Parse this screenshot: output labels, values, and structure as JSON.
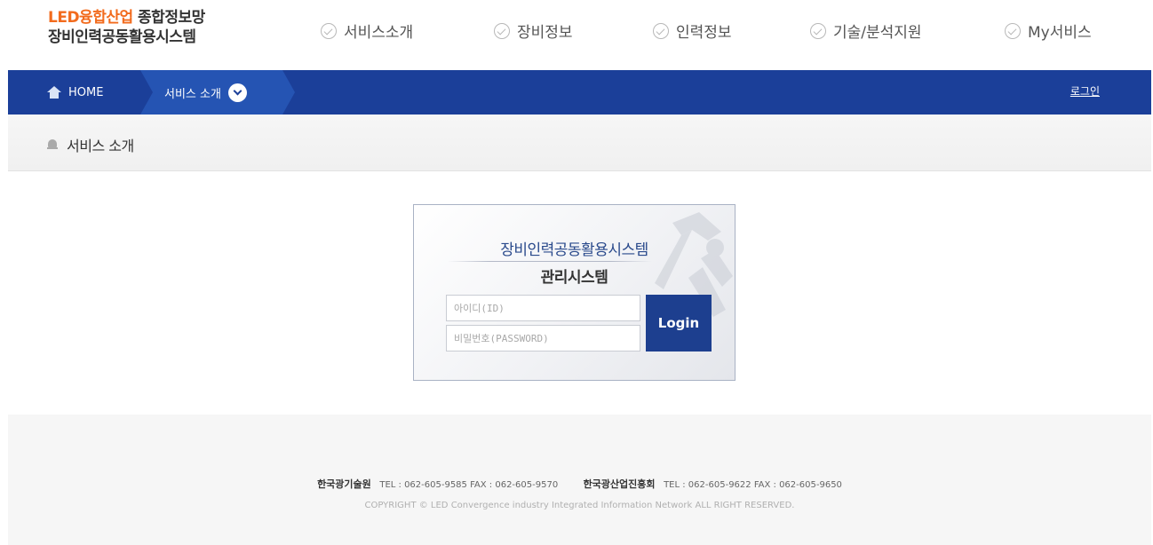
{
  "header": {
    "logo": {
      "orange_text": "LED융합산업",
      "dark_text": "종합정보망",
      "line2": "장비인력공동활용시스템"
    },
    "menu": [
      {
        "label": "서비스소개",
        "icon": "check-circle-icon"
      },
      {
        "label": "장비정보",
        "icon": "check-circle-icon"
      },
      {
        "label": "인력정보",
        "icon": "check-circle-icon"
      },
      {
        "label": "기술/분석지원",
        "icon": "check-circle-icon"
      },
      {
        "label": "My서비스",
        "icon": "check-circle-icon"
      }
    ]
  },
  "navbar": {
    "home_label": "HOME",
    "breadcrumb_label": "서비스 소개",
    "login_label": "로그인",
    "colors": {
      "bar": "#1b3f99",
      "crumb": "#2554b3"
    }
  },
  "subbar": {
    "title": "서비스 소개"
  },
  "login_box": {
    "title1": "장비인력공동활용시스템",
    "title2": "관리시스템",
    "id_placeholder": "아이디(ID)",
    "pw_placeholder": "비밀번호(PASSWORD)",
    "button_label": "Login"
  },
  "footer": {
    "org1": "한국광기술원",
    "org1_contact": "TEL : 062-605-9585   FAX : 062-605-9570",
    "org2": "한국광산업진흥회",
    "org2_contact": "TEL : 062-605-9622   FAX : 062-605-9650",
    "copyright": "COPYRIGHT © LED Convergence industry Integrated Information Network ALL RIGHT RESERVED."
  }
}
